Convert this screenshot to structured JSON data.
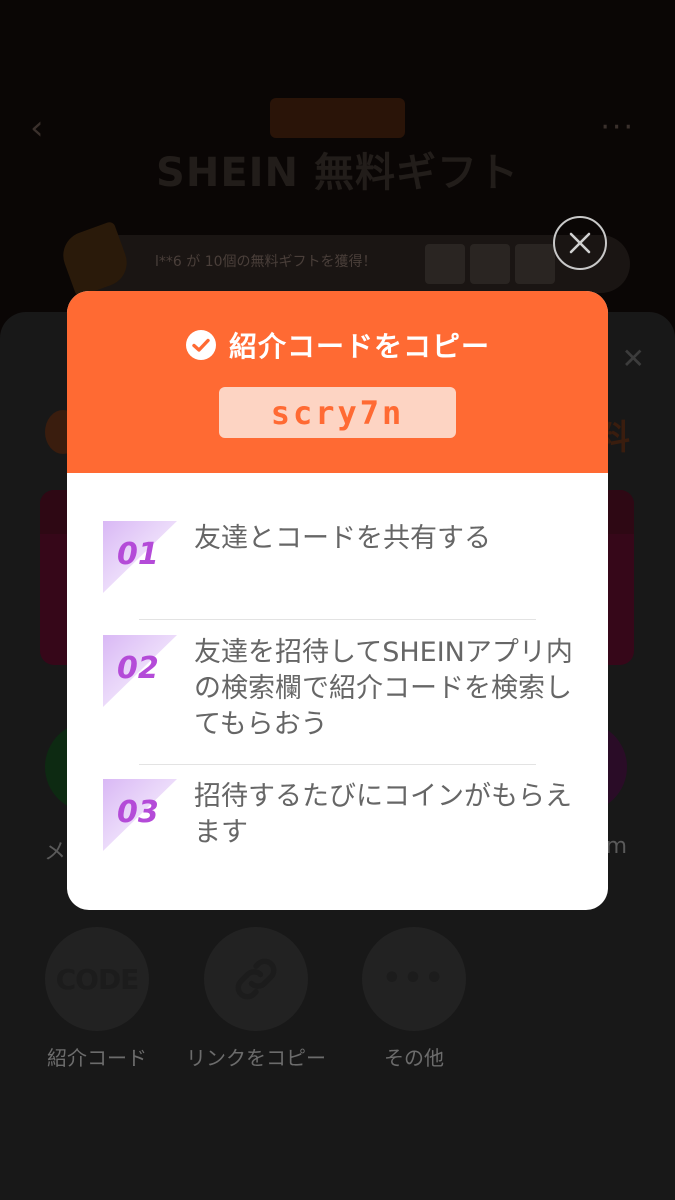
{
  "background": {
    "title": "SHEIN 無料ギフト",
    "ticker_text": "l**6 が 10個の無料ギフトを獲得！",
    "fee_fragment": "料",
    "share_left_label": "メ",
    "share_right_label": "m",
    "actions": [
      {
        "label": "紹介コード",
        "icon": "code-icon",
        "icon_text": "CODE"
      },
      {
        "label": "リンクをコピー",
        "icon": "link-icon"
      },
      {
        "label": "その他",
        "icon": "more-icon",
        "icon_text": "•••"
      }
    ]
  },
  "modal": {
    "header_title": "紹介コードをコピー",
    "code": "scry7n",
    "steps": [
      {
        "num": "01",
        "text": "友達とコードを共有する"
      },
      {
        "num": "02",
        "text": "友達を招待してSHEINアプリ内の検索欄で紹介コードを検索してもらおう"
      },
      {
        "num": "03",
        "text": "招待するたびにコインがもらえます"
      }
    ]
  },
  "colors": {
    "header_orange": "#ff6a33",
    "code_bg": "#fdd4c3",
    "step_purple": "#b44bd8"
  }
}
